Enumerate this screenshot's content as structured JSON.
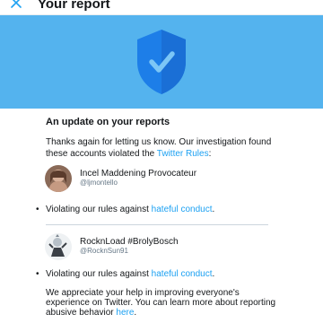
{
  "header": {
    "title": "Your report",
    "close_icon": "close-icon"
  },
  "hero": {
    "icon": "shield-check-icon",
    "background": "#54b3ee",
    "shield_color": "#1d7ee8"
  },
  "report": {
    "heading": "An update on your reports",
    "intro_text": "Thanks again for letting us know. Our investigation found these accounts violated the ",
    "rules_link": "Twitter Rules",
    "intro_end": ":"
  },
  "accounts": [
    {
      "name": "Incel Maddening Provocateur",
      "handle": "@ljmontello",
      "violation_prefix": "Violating our rules against ",
      "violation_link": "hateful conduct",
      "violation_suffix": "."
    },
    {
      "name": "RocknLoad #BrolyBosch",
      "handle": "@RocknSun91",
      "violation_prefix": "Violating our rules against ",
      "violation_link": "hateful conduct",
      "violation_suffix": "."
    }
  ],
  "closing": {
    "text": "We appreciate your help in improving everyone's experience on Twitter. You can learn more about reporting abusive behavior ",
    "link": "here",
    "end": "."
  },
  "colors": {
    "link": "#1da1f2",
    "text": "#14171a",
    "muted": "#657786"
  }
}
